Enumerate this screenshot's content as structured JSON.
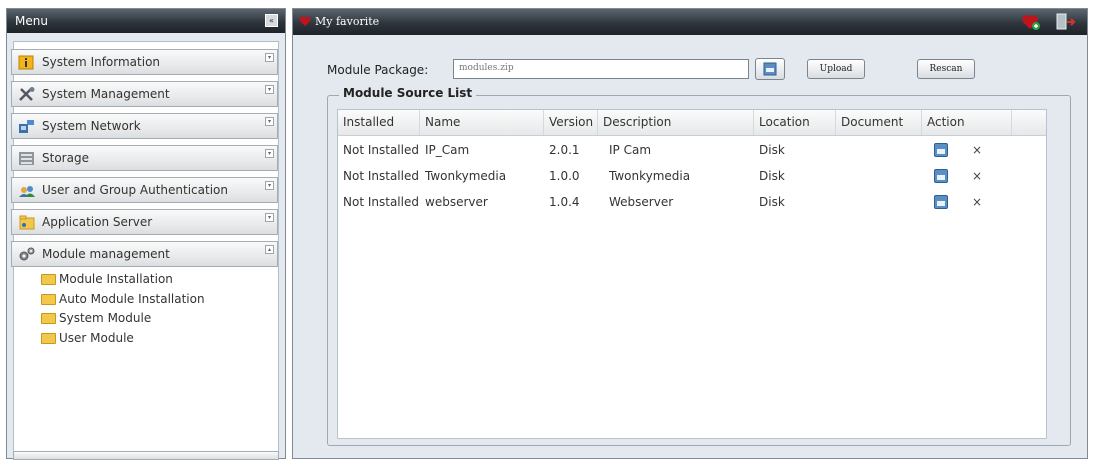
{
  "menu": {
    "title": "Menu",
    "sections": [
      {
        "label": "System Information",
        "icon": "info-icon"
      },
      {
        "label": "System Management",
        "icon": "tools-icon"
      },
      {
        "label": "System Network",
        "icon": "network-icon"
      },
      {
        "label": "Storage",
        "icon": "storage-icon"
      },
      {
        "label": "User and Group Authentication",
        "icon": "users-icon"
      },
      {
        "label": "Application Server",
        "icon": "server-icon"
      },
      {
        "label": "Module management",
        "icon": "gears-icon"
      }
    ],
    "sub_items": [
      {
        "label": "Module Installation"
      },
      {
        "label": "Auto Module Installation"
      },
      {
        "label": "System Module"
      },
      {
        "label": "User Module"
      }
    ]
  },
  "header": {
    "title": "My favorite"
  },
  "form": {
    "package_label": "Module Package:",
    "package_value": "modules.zip",
    "upload_label": "Upload",
    "rescan_label": "Rescan"
  },
  "list": {
    "legend": "Module Source List",
    "columns": [
      "Installed",
      "Name",
      "Version",
      "Description",
      "Location",
      "Document",
      "Action"
    ],
    "rows": [
      {
        "installed": "Not Installed",
        "name": "IP_Cam",
        "version": "2.0.1",
        "description": "IP Cam",
        "location": "Disk",
        "document": ""
      },
      {
        "installed": "Not Installed",
        "name": "Twonkymedia",
        "version": "1.0.0",
        "description": "Twonkymedia",
        "location": "Disk",
        "document": ""
      },
      {
        "installed": "Not Installed",
        "name": "webserver",
        "version": "1.0.4",
        "description": "Webserver",
        "location": "Disk",
        "document": ""
      }
    ],
    "delete_glyph": "×"
  },
  "colors": {
    "titlebar_dark": "#1e2328",
    "panel_bg": "#e3e9ee",
    "accent_red": "#c0141c"
  }
}
